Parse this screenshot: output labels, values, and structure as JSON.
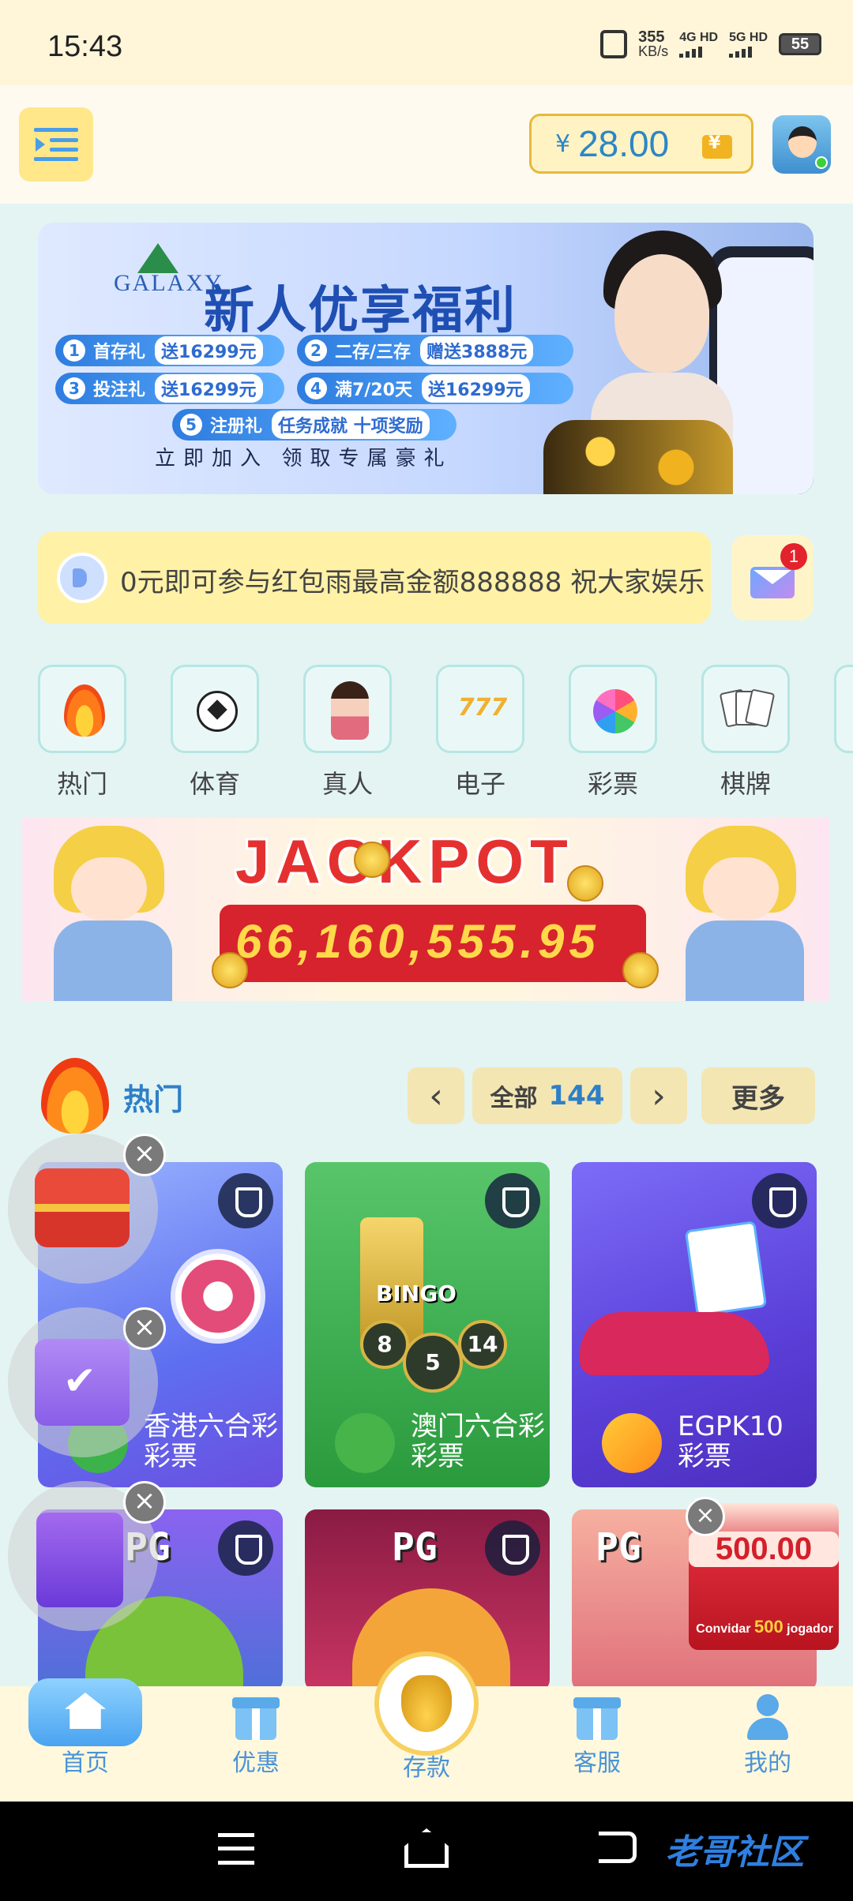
{
  "status_bar": {
    "time": "15:43",
    "net_speed": "355",
    "net_unit": "KB/s",
    "sim1": "4G HD",
    "sim2": "5G HD",
    "battery": "55"
  },
  "header": {
    "currency": "¥",
    "balance": "28.00"
  },
  "banner": {
    "logo": "GALAXY",
    "title": "新人优享福利",
    "rows": [
      {
        "num": "1",
        "label": "首存礼",
        "value": "送16299元"
      },
      {
        "num": "2",
        "label": "二存/三存",
        "value": "赠送3888元"
      },
      {
        "num": "3",
        "label": "投注礼",
        "value": "送16299元"
      },
      {
        "num": "4",
        "label": "满7/20天",
        "value": "送16299元"
      },
      {
        "num": "5",
        "label": "注册礼",
        "value": "任务成就 十项奖励"
      }
    ],
    "subtitle": "立即加入 领取专属豪礼"
  },
  "notice": {
    "text": "0元即可参与红包雨最高金额888888 祝大家娱乐",
    "mail_badge": "1"
  },
  "categories": [
    {
      "label": "热门",
      "icon": "fire-icon"
    },
    {
      "label": "体育",
      "icon": "soccer-ball-icon"
    },
    {
      "label": "真人",
      "icon": "live-dealer-icon"
    },
    {
      "label": "电子",
      "icon": "slot-777-icon"
    },
    {
      "label": "彩票",
      "icon": "lottery-pinwheel-icon"
    },
    {
      "label": "棋牌",
      "icon": "playing-cards-icon"
    }
  ],
  "jackpot": {
    "title": "JACKPOT",
    "amount": "66,160,555.95"
  },
  "hot_section": {
    "title": "热门",
    "all_label": "全部",
    "count": "144",
    "more_label": "更多"
  },
  "games": [
    {
      "name_line1": "香港六合彩",
      "name_line2": "彩票"
    },
    {
      "name_line1": "澳门六合彩",
      "name_line2": "彩票"
    },
    {
      "name_line1": "EGPK10",
      "name_line2": "彩票"
    },
    {
      "brand": "PG"
    },
    {
      "brand": "PG"
    },
    {
      "brand": "PG"
    }
  ],
  "bingo_balls": [
    "8",
    "5",
    "14"
  ],
  "bingo_text": "BINGO",
  "invite": {
    "amount": "500.00",
    "pre": "Convidar",
    "count": "500",
    "post": "jogador"
  },
  "bottom_nav": [
    {
      "label": "首页"
    },
    {
      "label": "优惠"
    },
    {
      "label": "存款"
    },
    {
      "label": "客服"
    },
    {
      "label": "我的"
    }
  ],
  "watermark": "老哥社区",
  "colors": {
    "accent_blue": "#2f7fc8",
    "header_bg": "#fffaf0",
    "page_bg": "#e3f4f3",
    "notice_bg": "#fff1a6",
    "jackpot_red": "#d7232e"
  }
}
